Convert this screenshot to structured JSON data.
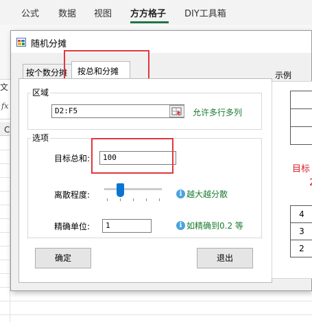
{
  "excel": {
    "ribbon_tabs": [
      "公式",
      "数据",
      "视图",
      "方方格子",
      "DIY工具箱"
    ],
    "active_tab": "方方格子",
    "fx_symbol": "fx",
    "left_text": "文",
    "column_letter": "C"
  },
  "dialog": {
    "title": "随机分摊",
    "tabs": [
      "按个数分摊",
      "按总和分摊"
    ],
    "active_tab": "按总和分摊",
    "area": {
      "group_label": "区域",
      "range_value": "D2:F5",
      "hint": "允许多行多列"
    },
    "options": {
      "group_label": "选项",
      "target_label": "目标总和:",
      "target_value": "100",
      "dispersion_label": "离散程度:",
      "dispersion_level": 0.2,
      "dispersion_hint": "越大越分散",
      "precision_label": "精确单位:",
      "precision_value": "1",
      "precision_hint": "如精确到0.2 等"
    },
    "buttons": {
      "ok": "确定",
      "cancel": "退出"
    },
    "example": {
      "title": "示例",
      "red_text_1": "目标",
      "red_text_2": "2",
      "cells": [
        "4",
        "3",
        "2"
      ]
    },
    "colors": {
      "highlight": "#e0353b",
      "hint_green": "#1a7a2d",
      "accent_blue": "#0a74d4",
      "example_red": "#d81e2a"
    }
  }
}
